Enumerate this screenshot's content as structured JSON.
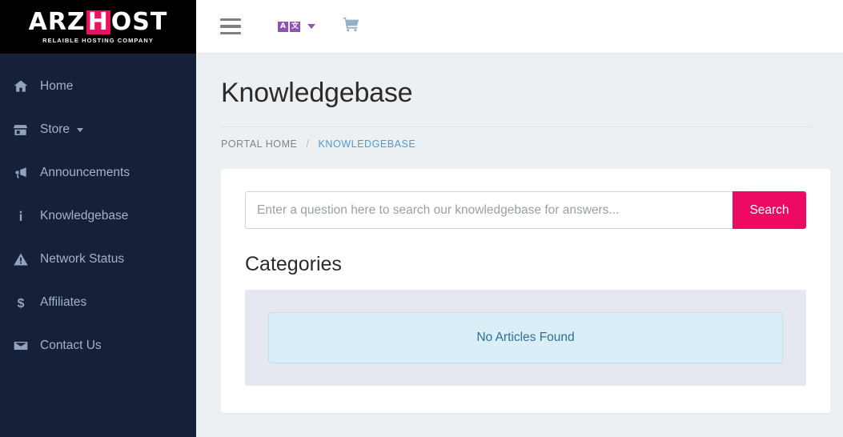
{
  "brand": {
    "logo_part1": "ARZ",
    "logo_highlight": "H",
    "logo_part2": "OST",
    "tagline": "RELAIBLE HOSTING COMPANY",
    "accent_color": "#ec0a62",
    "sidebar_color": "#172039",
    "logo_bg_color": "#000000"
  },
  "sidebar": {
    "items": [
      {
        "label": "Home",
        "icon": "home-icon"
      },
      {
        "label": "Store",
        "icon": "store-icon",
        "has_caret": true
      },
      {
        "label": "Announcements",
        "icon": "bullhorn-icon"
      },
      {
        "label": "Knowledgebase",
        "icon": "info-icon"
      },
      {
        "label": "Network Status",
        "icon": "warning-triangle-icon"
      },
      {
        "label": "Affiliates",
        "icon": "dollar-icon"
      },
      {
        "label": "Contact Us",
        "icon": "envelope-icon"
      }
    ]
  },
  "topbar": {
    "menu_toggle": "hamburger-icon",
    "language_icon": "translate-icon",
    "language_glyph_latin": "A",
    "language_glyph_cjk": "文",
    "cart_icon": "shopping-cart-icon"
  },
  "page": {
    "title": "Knowledgebase",
    "breadcrumb": {
      "home": "PORTAL HOME",
      "separator": "/",
      "current": "KNOWLEDGEBASE"
    }
  },
  "search": {
    "value": "",
    "placeholder": "Enter a question here to search our knowledgebase for answers...",
    "button_label": "Search"
  },
  "categories": {
    "heading": "Categories",
    "empty_message": "No Articles Found",
    "empty_bg_color": "#d9eef7",
    "empty_text_color": "#31708f"
  }
}
